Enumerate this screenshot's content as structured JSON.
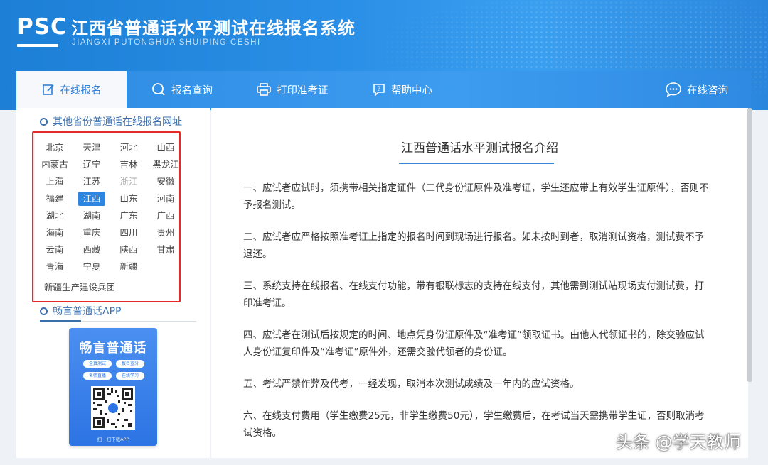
{
  "header": {
    "logo": "PSC",
    "title": "江西省普通话水平测试在线报名系统",
    "subtitle": "JIANGXI PUTONGHUA SHUIPING CESHI"
  },
  "nav": {
    "items": [
      {
        "label": "在线报名",
        "icon": "edit-icon",
        "active": true
      },
      {
        "label": "报名查询",
        "icon": "search-icon"
      },
      {
        "label": "打印准考证",
        "icon": "printer-icon"
      },
      {
        "label": "帮助中心",
        "icon": "help-icon"
      }
    ],
    "consult": {
      "label": "在线咨询",
      "icon": "chat-icon"
    }
  },
  "sidebar": {
    "provinces_heading": "其他省份普通话在线报名网址",
    "provinces": [
      "北京",
      "天津",
      "河北",
      "山西",
      "内蒙古",
      "辽宁",
      "吉林",
      "黑龙江",
      "上海",
      "江苏",
      "浙江",
      "安徽",
      "福建",
      "江西",
      "山东",
      "河南",
      "湖北",
      "湖南",
      "广东",
      "广西",
      "海南",
      "重庆",
      "四川",
      "贵州",
      "云南",
      "西藏",
      "陕西",
      "甘肃",
      "青海",
      "宁夏",
      "新疆"
    ],
    "selected": "江西",
    "disabled": [
      "浙江"
    ],
    "bingtuan": "新疆生产建设兵团",
    "app_heading": "畅言普通话APP",
    "app": {
      "title": "畅言普通话",
      "chips": [
        "全真测试",
        "报名查分",
        "名师直播",
        "在线学习"
      ],
      "caption": "扫一扫下载APP"
    }
  },
  "main": {
    "title": "江西普通话水平测试报名介绍",
    "paragraphs": [
      "一、应试者应试时，须携带相关指定证件（二代身份证原件及准考证，学生还应带上有效学生证原件），否则不予报名测试。",
      "二、应试者应严格按照准考证上指定的报名时间到现场进行报名。如未按时到者，取消测试资格，测试费不予退还。",
      "三、系统支持在线报名、在线支付功能，带有银联标志的支持在线支付，其他需到测试站现场支付测试费，打印准考证。",
      "四、应试者在测试后按规定的时间、地点凭身份证原件及“准考证”领取证书。由他人代领证书的，除交验应试人身份证复印件及“准考证”原件外，还需交验代领者的身份证。",
      "五、考试严禁作弊及代考，一经发现，取消本次测试成绩及一年内的应试资格。",
      "六、在线支付费用（学生缴费25元，非学生缴费50元），学生缴费后，在考试当天需携带学生证，否则取消考试资格。"
    ]
  },
  "watermark": "头条 @学天教师",
  "colors": {
    "brand": "#2a8fe6",
    "active_text": "#2f7fd6",
    "highlight_box": "#e52a2a",
    "selected_province": "#2e86e0"
  }
}
